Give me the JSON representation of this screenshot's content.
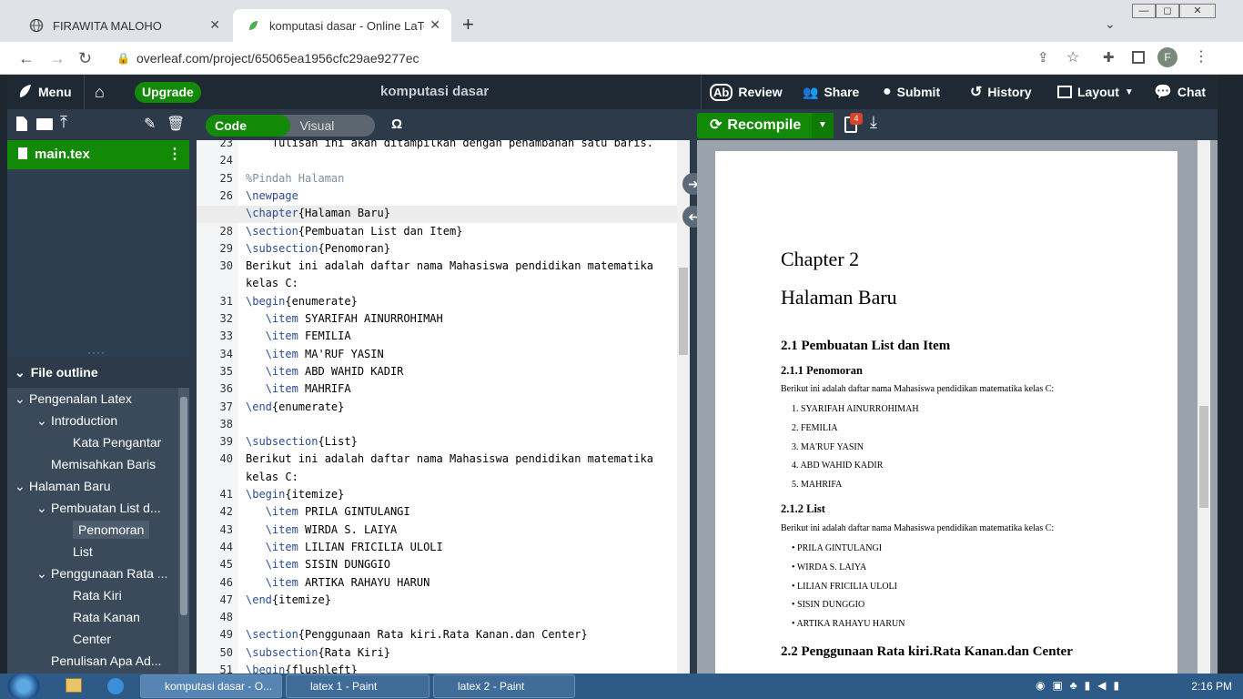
{
  "browser": {
    "tabs": [
      {
        "title": "FIRAWITA MALOHO",
        "close": "✕"
      },
      {
        "title": "komputasi dasar - Online LaTeX",
        "close": "✕"
      }
    ],
    "new_tab": "+",
    "url": "overleaf.com/project/65065ea1956cfc29ae9277ec",
    "profile_initial": "F",
    "window_controls": [
      "—",
      "◻",
      "✕"
    ]
  },
  "topbar": {
    "menu": "Menu",
    "upgrade": "Upgrade",
    "project_title": "komputasi dasar",
    "review": "Review",
    "share": "Share",
    "submit": "Submit",
    "history": "History",
    "layout": "Layout",
    "chat": "Chat"
  },
  "file_panel": {
    "main_file": "main.tex",
    "outline_title": "File outline",
    "outline": [
      {
        "label": "Pengenalan Latex",
        "level": 0,
        "arrow": "⌄"
      },
      {
        "label": "Introduction",
        "level": 1,
        "arrow": "⌄"
      },
      {
        "label": "Kata Pengantar",
        "level": 2,
        "arrow": ""
      },
      {
        "label": "Memisahkan Baris",
        "level": 1,
        "arrow": ""
      },
      {
        "label": "Halaman Baru",
        "level": 0,
        "arrow": "⌄"
      },
      {
        "label": "Pembuatan List d...",
        "level": 1,
        "arrow": "⌄"
      },
      {
        "label": "Penomoran",
        "level": 2,
        "arrow": "",
        "selected": true
      },
      {
        "label": "List",
        "level": 2,
        "arrow": ""
      },
      {
        "label": "Penggunaan Rata ...",
        "level": 1,
        "arrow": "⌄"
      },
      {
        "label": "Rata Kiri",
        "level": 2,
        "arrow": ""
      },
      {
        "label": "Rata Kanan",
        "level": 2,
        "arrow": ""
      },
      {
        "label": "Center",
        "level": 2,
        "arrow": ""
      },
      {
        "label": "Penulisan Apa Ad...",
        "level": 1,
        "arrow": ""
      }
    ]
  },
  "editor": {
    "code_editor": "Code Editor",
    "visual_editor": "Visual Editor",
    "omega": "Ω",
    "lines": [
      {
        "n": "23",
        "text": "    Tulisan ini akan ditampilkan dengan penambahan satu baris."
      },
      {
        "n": "24",
        "text": ""
      },
      {
        "n": "25",
        "text": "%Pindah Halaman"
      },
      {
        "n": "26",
        "text": "\\newpage"
      },
      {
        "n": "27",
        "text": "\\chapter{Halaman Baru}"
      },
      {
        "n": "28",
        "text": "\\section{Pembuatan List dan Item}"
      },
      {
        "n": "29",
        "text": "\\subsection{Penomoran}"
      },
      {
        "n": "30",
        "text": "Berikut ini adalah daftar nama Mahasiswa pendidikan matematika"
      },
      {
        "n": "",
        "text": "kelas C:"
      },
      {
        "n": "31",
        "text": "\\begin{enumerate}"
      },
      {
        "n": "32",
        "text": "   \\item SYARIFAH AINURROHIMAH"
      },
      {
        "n": "33",
        "text": "   \\item FEMILIA"
      },
      {
        "n": "34",
        "text": "   \\item MA'RUF YASIN"
      },
      {
        "n": "35",
        "text": "   \\item ABD WAHID KADIR"
      },
      {
        "n": "36",
        "text": "   \\item MAHRIFA"
      },
      {
        "n": "37",
        "text": "\\end{enumerate}"
      },
      {
        "n": "38",
        "text": ""
      },
      {
        "n": "39",
        "text": "\\subsection{List}"
      },
      {
        "n": "40",
        "text": "Berikut ini adalah daftar nama Mahasiswa pendidikan matematika"
      },
      {
        "n": "",
        "text": "kelas C:"
      },
      {
        "n": "41",
        "text": "\\begin{itemize}"
      },
      {
        "n": "42",
        "text": "   \\item PRILA GINTULANGI"
      },
      {
        "n": "43",
        "text": "   \\item WIRDA S. LAIYA"
      },
      {
        "n": "44",
        "text": "   \\item LILIAN FRICILIA ULOLI"
      },
      {
        "n": "45",
        "text": "   \\item SISIN DUNGGIO"
      },
      {
        "n": "46",
        "text": "   \\item ARTIKA RAHAYU HARUN"
      },
      {
        "n": "47",
        "text": "\\end{itemize}"
      },
      {
        "n": "48",
        "text": ""
      },
      {
        "n": "49",
        "text": "\\section{Penggunaan Rata kiri.Rata Kanan.dan Center}"
      },
      {
        "n": "50",
        "text": "\\subsection{Rata Kiri}"
      },
      {
        "n": "51",
        "text": "\\begin{flushleft}"
      }
    ]
  },
  "preview": {
    "recompile": "Recompile",
    "log_badge": "4",
    "chapter": "Chapter 2",
    "chapter_title": "Halaman Baru",
    "section1": "2.1    Pembuatan List dan Item",
    "subsection1": "2.1.1    Penomoran",
    "intro1": "Berikut ini adalah daftar nama Mahasiswa pendidikan matematika kelas C:",
    "enum_items": [
      "1.  SYARIFAH AINURROHIMAH",
      "2.  FEMILIA",
      "3.  MA'RUF YASIN",
      "4.  ABD WAHID KADIR",
      "5.  MAHRIFA"
    ],
    "subsection2": "2.1.2    List",
    "intro2": "Berikut ini adalah daftar nama Mahasiswa pendidikan matematika kelas C:",
    "bullet_items": [
      "•  PRILA GINTULANGI",
      "•  WIRDA S. LAIYA",
      "•  LILIAN FRICILIA ULOLI",
      "•  SISIN DUNGGIO",
      "•  ARTIKA RAHAYU HARUN"
    ],
    "section2": "2.2    Penggunaan Rata kiri.Rata Kanan.dan Center"
  },
  "taskbar": {
    "items": [
      "komputasi dasar - O...",
      "latex 1 - Paint",
      "latex 2 - Paint"
    ],
    "clock": "2:16 PM"
  },
  "colors": {
    "overleaf_green": "#138a07",
    "dark_panel": "#2c3e50",
    "topbar": "#1f2933"
  }
}
